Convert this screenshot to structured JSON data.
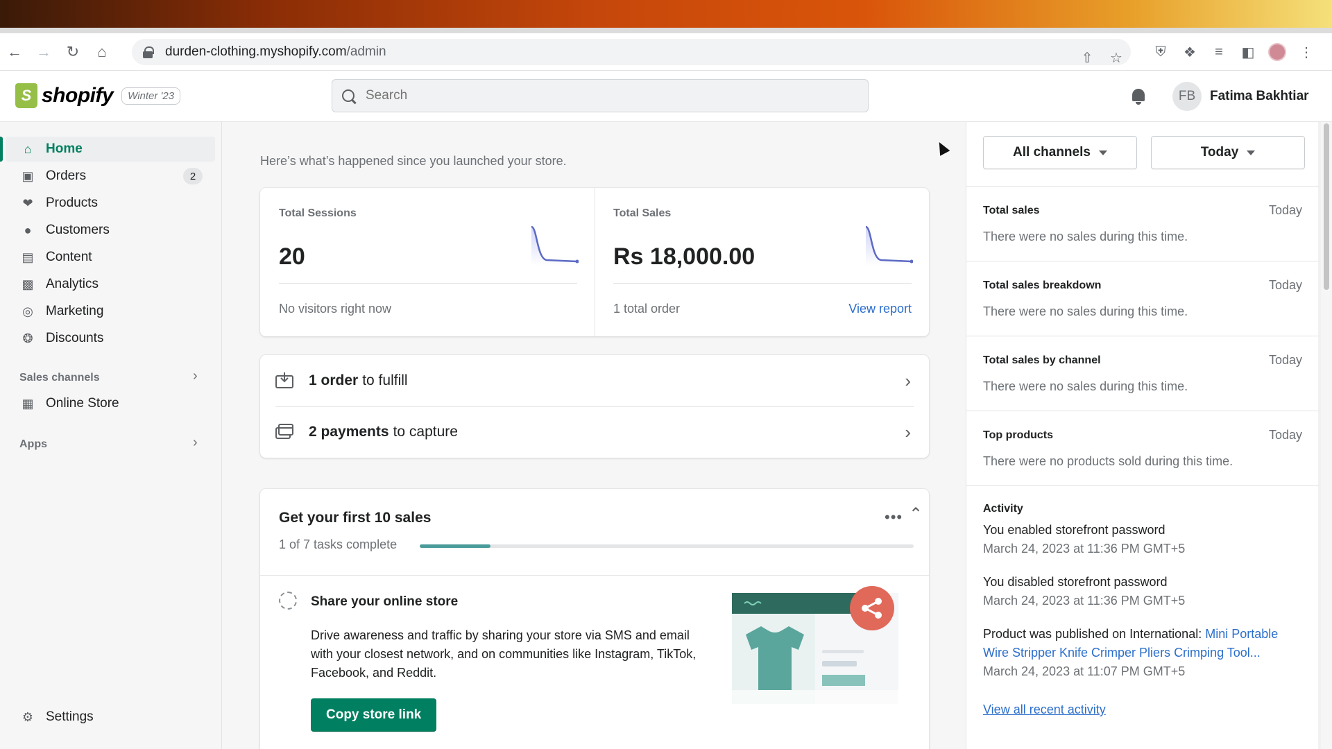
{
  "browser": {
    "url_host": "durden-clothing.myshopify.com",
    "url_path": "/admin"
  },
  "header": {
    "brand": "shopify",
    "edition_badge": "Winter '23",
    "search_placeholder": "Search",
    "user_initials": "FB",
    "user_name": "Fatima Bakhtiar"
  },
  "sidebar": {
    "items": [
      {
        "label": "Home"
      },
      {
        "label": "Orders",
        "badge": "2"
      },
      {
        "label": "Products"
      },
      {
        "label": "Customers"
      },
      {
        "label": "Content"
      },
      {
        "label": "Analytics"
      },
      {
        "label": "Marketing"
      },
      {
        "label": "Discounts"
      }
    ],
    "sales_channels_label": "Sales channels",
    "online_store_label": "Online Store",
    "apps_label": "Apps",
    "settings_label": "Settings"
  },
  "main": {
    "intro": "Here’s what’s happened since you launched your store.",
    "sessions": {
      "label": "Total Sessions",
      "value": "20",
      "footer": "No visitors right now"
    },
    "sales": {
      "label": "Total Sales",
      "value": "Rs 18,000.00",
      "footer": "1 total order",
      "link": "View report"
    },
    "todos": [
      {
        "bold": "1 order",
        "rest": "to fulfill"
      },
      {
        "bold": "2 payments",
        "rest": "to capture"
      }
    ],
    "setup": {
      "title": "Get your first 10 sales",
      "progress_text": "1 of 7 tasks complete",
      "progress_fraction": 0.143,
      "task_title": "Share your online store",
      "task_desc": "Drive awareness and traffic by sharing your store via SMS and email with your closest network, and on communities like Instagram, TikTok, Facebook, and Reddit.",
      "button_label": "Copy store link"
    }
  },
  "right_panel": {
    "channel_filter": "All channels",
    "date_filter": "Today",
    "sections": [
      {
        "title": "Total sales",
        "date": "Today",
        "text": "There were no sales during this time."
      },
      {
        "title": "Total sales breakdown",
        "date": "Today",
        "text": "There were no sales during this time."
      },
      {
        "title": "Total sales by channel",
        "date": "Today",
        "text": "There were no sales during this time."
      },
      {
        "title": "Top products",
        "date": "Today",
        "text": "There were no products sold during this time."
      }
    ],
    "activity": {
      "title": "Activity",
      "items": [
        {
          "text": "You enabled storefront password",
          "time": "March 24, 2023 at 11:36 PM GMT+5"
        },
        {
          "text": "You disabled storefront password",
          "time": "March 24, 2023 at 11:36 PM GMT+5"
        },
        {
          "text": "Product was published on International:",
          "link": "Mini Portable Wire Stripper Knife Crimper Pliers Crimping Tool...",
          "time": "March 24, 2023 at 11:07 PM GMT+5"
        }
      ],
      "view_all": "View all recent activity"
    }
  },
  "colors": {
    "accent_green": "#008060",
    "link_blue": "#2c6ecb",
    "progress_teal": "#4a9c9b",
    "share_red": "#e0695a",
    "spark_purple": "#5c6ac4"
  }
}
